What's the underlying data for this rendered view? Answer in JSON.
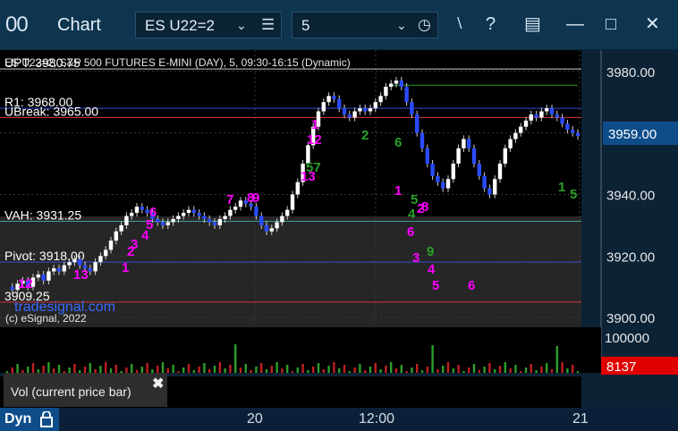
{
  "window": {
    "logo": "00",
    "title": "Chart",
    "symbol": "ES U22=2",
    "interval": "5",
    "icons": [
      "list-icon",
      "chevron-down-icon",
      "clock-icon",
      "pin-icon",
      "help-icon",
      "page-setup-icon",
      "minimize-icon",
      "maximize-icon",
      "close-icon"
    ]
  },
  "chart": {
    "header": "ES U22=2, S&P 500 FUTURES E-MINI (DAY), 5, 09:30-16:15 (Dynamic)",
    "watermark": "(c) eSignal, 2022",
    "watermark_site": "tradesignal.com",
    "y_ticks": [
      "3980.00",
      "3960.00",
      "3940.00",
      "3920.00",
      "3900.00"
    ],
    "current_price": "3959.00",
    "current_price_color": "#0e4d8a",
    "level_lines": [
      {
        "label": "UPT: 3980.75",
        "value": 3980.75,
        "color": "#cccccc"
      },
      {
        "label": "R1: 3968.00",
        "value": 3968.0,
        "color": "#3a4bd8"
      },
      {
        "label": "UBreak: 3965.00",
        "value": 3965.0,
        "color": "#d43a3a"
      },
      {
        "label": "VAH: 3931.25",
        "value": 3931.25,
        "color": "#3aa0a0"
      },
      {
        "label": "Pivot: 3918.00",
        "value": 3918.0,
        "color": "#3a4bd8"
      },
      {
        "label": "3909.25",
        "value": 3905.0,
        "color": "#d43a3a"
      }
    ],
    "counts": [
      {
        "text": "12",
        "color": "#ff00ff"
      },
      {
        "text": "13",
        "color": "#ff00ff"
      },
      {
        "text": "7",
        "color": "#ff00ff"
      },
      {
        "text": "8",
        "color": "#ff00ff"
      },
      {
        "text": "9",
        "color": "#ff00ff"
      },
      {
        "text": "6",
        "color": "#ff00ff"
      },
      {
        "text": "5",
        "color": "#ff00ff"
      },
      {
        "text": "4",
        "color": "#ff00ff"
      },
      {
        "text": "3",
        "color": "#ff00ff"
      },
      {
        "text": "2",
        "color": "#ff00ff"
      },
      {
        "text": "1",
        "color": "#ff00ff"
      },
      {
        "text": "12",
        "color": "#ff00ff"
      },
      {
        "text": "1",
        "color": "#ff00ff"
      },
      {
        "text": "13",
        "color": "#ff00ff"
      },
      {
        "text": "1",
        "color": "#ff00ff"
      },
      {
        "text": "2",
        "color": "#ff00ff"
      },
      {
        "text": "3",
        "color": "#ff00ff"
      },
      {
        "text": "4",
        "color": "#ff00ff"
      },
      {
        "text": "5",
        "color": "#ff00ff"
      },
      {
        "text": "6",
        "color": "#ff00ff"
      },
      {
        "text": "6",
        "color": "#ff00ff"
      },
      {
        "text": "8",
        "color": "#ff00ff"
      },
      {
        "text": "9",
        "color": "#2aa02a"
      },
      {
        "text": "4",
        "color": "#2aa02a"
      },
      {
        "text": "5",
        "color": "#2aa02a"
      },
      {
        "text": "6",
        "color": "#2aa02a"
      },
      {
        "text": "2",
        "color": "#2aa02a"
      },
      {
        "text": "1",
        "color": "#2aa02a"
      },
      {
        "text": "5",
        "color": "#2aa02a"
      },
      {
        "text": "57",
        "color": "#2aa02a"
      }
    ],
    "volume_axis": "100000",
    "volume_value": "8137",
    "volume_value_color": "#e00000",
    "volume_panel_label": "Vol (current price bar)",
    "volume_close": "x",
    "x_labels": [
      "20",
      "12:00",
      "21"
    ],
    "mode": "Dyn"
  },
  "chart_data": {
    "type": "candlestick",
    "ylim": [
      3898,
      3984
    ],
    "series": [
      {
        "name": "price",
        "values": [
          3910,
          3909,
          3911,
          3912,
          3910,
          3913,
          3914,
          3912,
          3915,
          3916,
          3915,
          3917,
          3918,
          3919,
          3917,
          3916,
          3915,
          3918,
          3920,
          3922,
          3925,
          3928,
          3930,
          3933,
          3934,
          3936,
          3935,
          3934,
          3932,
          3931,
          3930,
          3931,
          3932,
          3933,
          3934,
          3935,
          3934,
          3933,
          3932,
          3931,
          3930,
          3932,
          3933,
          3935,
          3936,
          3938,
          3937,
          3936,
          3933,
          3930,
          3928,
          3929,
          3931,
          3933,
          3935,
          3940,
          3944,
          3950,
          3956,
          3962,
          3967,
          3970,
          3972,
          3971,
          3968,
          3966,
          3965,
          3967,
          3968,
          3967,
          3968,
          3970,
          3972,
          3975,
          3976,
          3977,
          3975,
          3970,
          3966,
          3960,
          3955,
          3950,
          3946,
          3944,
          3942,
          3945,
          3950,
          3955,
          3958,
          3955,
          3950,
          3946,
          3942,
          3940,
          3945,
          3950,
          3955,
          3958,
          3960,
          3962,
          3964,
          3966,
          3965,
          3967,
          3968,
          3966,
          3965,
          3963,
          3961,
          3960,
          3959
        ]
      }
    ]
  }
}
